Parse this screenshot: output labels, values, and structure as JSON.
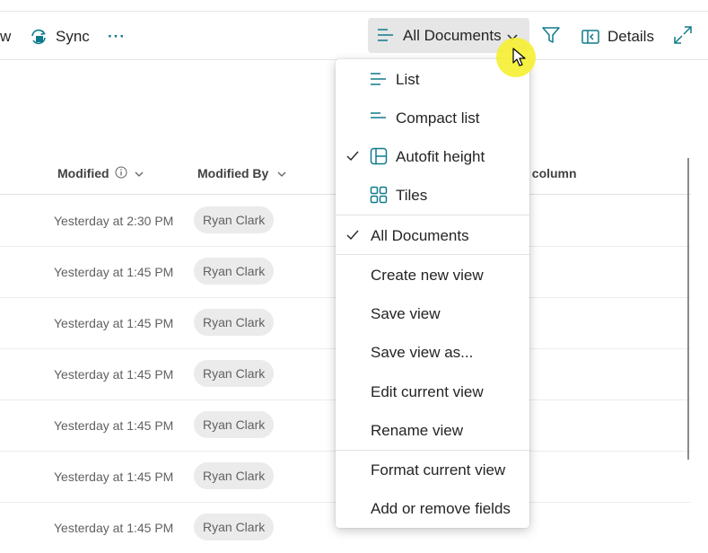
{
  "toolbar": {
    "partial_left": "w",
    "sync_label": "Sync",
    "more_label": "···",
    "view_label": "All Documents",
    "details_label": "Details"
  },
  "headers": {
    "modified": "Modified",
    "modified_by": "Modified By",
    "add_column_partial": "l column"
  },
  "rows": [
    {
      "modified": "Yesterday at 2:30 PM",
      "modified_by": "Ryan Clark"
    },
    {
      "modified": "Yesterday at 1:45 PM",
      "modified_by": "Ryan Clark"
    },
    {
      "modified": "Yesterday at 1:45 PM",
      "modified_by": "Ryan Clark"
    },
    {
      "modified": "Yesterday at 1:45 PM",
      "modified_by": "Ryan Clark"
    },
    {
      "modified": "Yesterday at 1:45 PM",
      "modified_by": "Ryan Clark"
    },
    {
      "modified": "Yesterday at 1:45 PM",
      "modified_by": "Ryan Clark"
    },
    {
      "modified": "Yesterday at 1:45 PM",
      "modified_by": "Ryan Clark"
    }
  ],
  "menu": {
    "layout_items": [
      {
        "label": "List",
        "icon": "list-icon",
        "checked": false
      },
      {
        "label": "Compact list",
        "icon": "compact-list-icon",
        "checked": false
      },
      {
        "label": "Autofit height",
        "icon": "autofit-height-icon",
        "checked": true
      },
      {
        "label": "Tiles",
        "icon": "tiles-icon",
        "checked": false
      }
    ],
    "current_view": {
      "label": "All Documents",
      "checked": true
    },
    "view_actions": [
      "Create new view",
      "Save view",
      "Save view as...",
      "Edit current view",
      "Rename view"
    ],
    "format_actions": [
      "Format current view",
      "Add or remove fields"
    ]
  },
  "colors": {
    "accent": "#0f7b8a",
    "selected_button_bg": "#e6e6e6",
    "chip_bg": "#ebebeb"
  }
}
